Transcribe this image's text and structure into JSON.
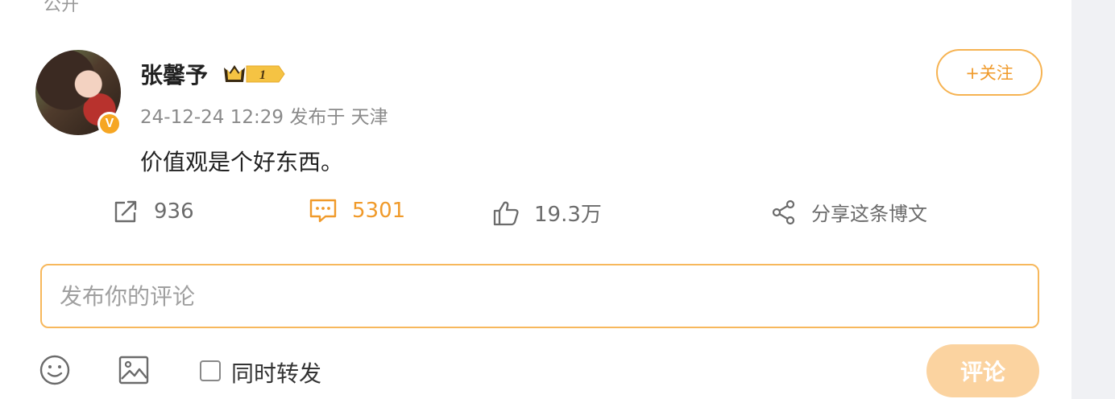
{
  "post": {
    "visibility_label": "公开",
    "author": {
      "name": "张馨予",
      "vip_level": "1",
      "verified_mark": "V"
    },
    "meta": {
      "time": "24-12-24 12:29",
      "location": "发布于 天津"
    },
    "text": "价值观是个好东西。",
    "follow_label": "+关注",
    "actions": {
      "repost_count": "936",
      "comment_count": "5301",
      "like_count": "19.3万",
      "share_label": "分享这条博文"
    }
  },
  "composer": {
    "placeholder": "发布你的评论",
    "repost_label": "同时转发",
    "submit_label": "评论"
  },
  "icons": {
    "repost": "repost-icon",
    "comment": "comment-icon",
    "like": "thumbs-up-icon",
    "share": "share-icon",
    "emoji": "emoji-icon",
    "image": "image-icon",
    "crown": "crown-icon"
  },
  "colors": {
    "accent": "#f09a2a",
    "input_border": "#f7b85c",
    "submit_bg": "#fbd3a0"
  }
}
